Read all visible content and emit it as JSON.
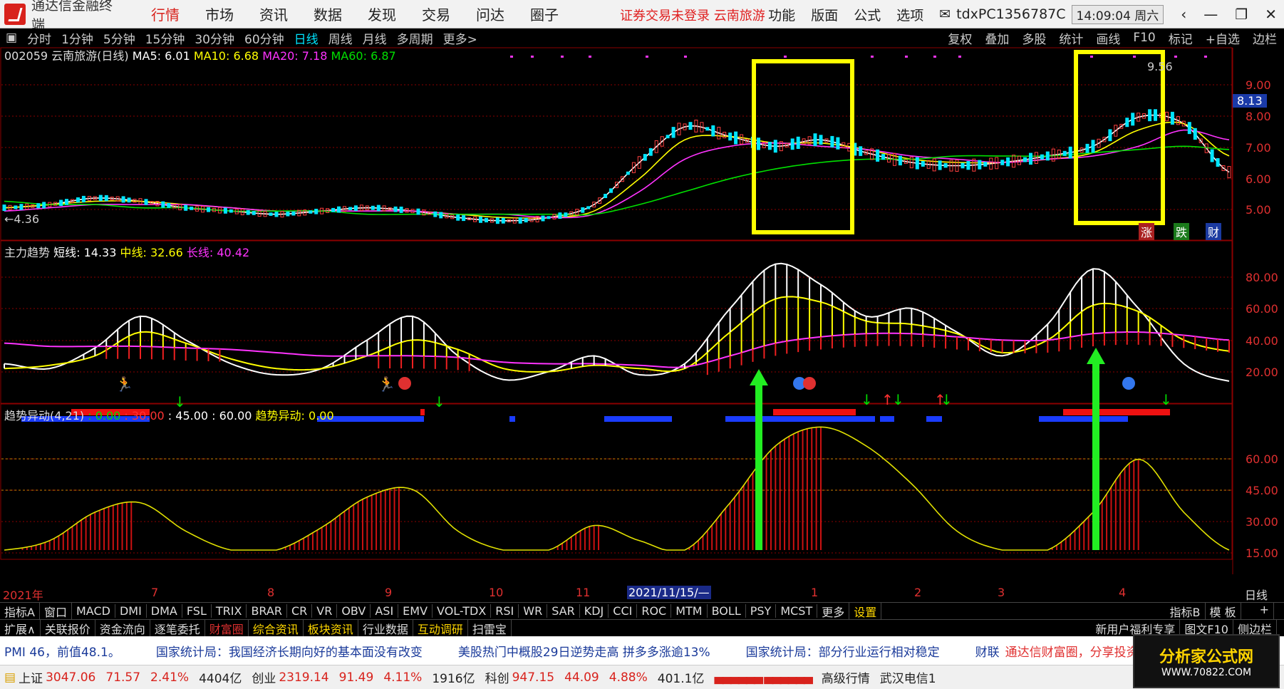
{
  "app": {
    "title": "通达信金融终端",
    "menu": [
      "行情",
      "市场",
      "资讯",
      "数据",
      "发现",
      "交易",
      "问达",
      "圈子"
    ],
    "active_menu": 0,
    "alert": "证券交易未登录  云南旅游",
    "right_menu": [
      "功能",
      "版面",
      "公式",
      "选项"
    ],
    "account": "tdxPC1356787C",
    "clock": "14:09:04 周六",
    "window_controls": [
      "‹",
      "—",
      "❐",
      "✕"
    ]
  },
  "periods": [
    "分时",
    "1分钟",
    "5分钟",
    "15分钟",
    "30分钟",
    "60分钟",
    "日线",
    "周线",
    "月线",
    "多周期",
    "更多>"
  ],
  "active_period": "日线",
  "toolbar_right": [
    "复权",
    "叠加",
    "多股",
    "统计",
    "画线",
    "F10",
    "标记",
    "+自选",
    "边栏"
  ],
  "main_panel": {
    "legend": [
      "002059 云南旅游(日线)",
      "MA5: 6.01",
      "MA10: 6.68",
      "MA20: 7.18",
      "MA60: 6.87"
    ],
    "legend_colors": [
      "#dddddd",
      "#ffffff",
      "#ffff00",
      "#ff33ff",
      "#00e000"
    ],
    "y_ticks": [
      "9.00",
      "8.00",
      "7.00",
      "6.00",
      "5.00"
    ],
    "price_tag": "8.13",
    "low_label": "←4.36",
    "high_label": "9.56",
    "badges": [
      "涨",
      "跌",
      "财"
    ]
  },
  "mid_panel": {
    "legend": [
      "主力趋势",
      "短线: 14.33",
      "中线: 32.66",
      "长线: 40.42"
    ],
    "legend_colors": [
      "#dddddd",
      "#ffffff",
      "#ffff00",
      "#ff33ff"
    ],
    "y_ticks": [
      "80.00",
      "60.00",
      "40.00",
      "20.00"
    ]
  },
  "low_panel": {
    "legend": [
      "趋势异动(4,21)",
      ": 0.00",
      ": 30.00",
      ": 45.00",
      ": 60.00",
      "趋势异动: 0.00"
    ],
    "legend_colors": [
      "#dddddd",
      "#00e000",
      "#ff3333",
      "#ffffff",
      "#ffffff",
      "#ffff00"
    ],
    "y_ticks": [
      "60.00",
      "45.00",
      "30.00",
      "15.00"
    ]
  },
  "x_axis": {
    "labels": [
      "2021年",
      "7",
      "8",
      "9",
      "10",
      "11",
      "2021/11/15/—",
      "1",
      "2",
      "3",
      "4"
    ],
    "right_label": "日线"
  },
  "indicator_tabs": [
    "指标A",
    "窗口",
    "MACD",
    "DMI",
    "DMA",
    "FSL",
    "TRIX",
    "BRAR",
    "CR",
    "VR",
    "OBV",
    "ASI",
    "EMV",
    "VOL-TDX",
    "RSI",
    "WR",
    "SAR",
    "KDJ",
    "CCI",
    "ROC",
    "MTM",
    "BOLL",
    "PSY",
    "MCST",
    "更多",
    "设置"
  ],
  "indicator_tabs_right": [
    "指标B",
    "模 板",
    "+"
  ],
  "ext_tabs": [
    "扩展∧",
    "关联报价",
    "资金流向",
    "逐笔委托",
    "财富圈",
    "综合资讯",
    "板块资讯",
    "行业数据",
    "互动调研",
    "扫雷宝"
  ],
  "ext_tabs_right": [
    "新用户福利专享",
    "图文F10",
    "侧边栏"
  ],
  "news": [
    "PMI 46，前值48.1。",
    "国家统计局：我国经济长期向好的基本面没有改变",
    "美股热门中概股29日逆势走高 拼多多涨逾13%",
    "国家统计局：部分行业运行相对稳定",
    "财联",
    "通达信财富圈，分享投资"
  ],
  "status": {
    "sh_label": "上证",
    "sh_price": "3047.06",
    "sh_chg": "71.57",
    "sh_pct": "2.41%",
    "sh_vol": "4404亿",
    "cy_label": "创业",
    "cy_price": "2319.14",
    "cy_chg": "91.49",
    "cy_pct": "4.11%",
    "cy_vol": "1916亿",
    "kc_label": "科创",
    "kc_price": "947.15",
    "kc_chg": "44.09",
    "kc_pct": "4.88%",
    "kc_vol": "401.1亿",
    "quote_level": "高级行情",
    "server": "武汉电信1"
  },
  "brand": {
    "name": "分析家公式网",
    "url": "WWW.70822.COM"
  },
  "chart_data": [
    {
      "type": "line",
      "title": "002059 云南旅游(日线)",
      "ylim": [
        4.3,
        9.8
      ],
      "series": [
        {
          "name": "MA5",
          "values": [
            5.1,
            5.2,
            5.4,
            5.3,
            5.1,
            5.0,
            4.9,
            5.0,
            5.1,
            5.0,
            4.8,
            4.7,
            4.8,
            5.2,
            6.5,
            7.6,
            7.3,
            7.0,
            7.2,
            6.8,
            6.5,
            6.4,
            6.5,
            6.7,
            7.0,
            7.9,
            7.7,
            6.2
          ]
        },
        {
          "name": "MA10",
          "values": [
            5.1,
            5.2,
            5.3,
            5.3,
            5.2,
            5.1,
            5.0,
            5.0,
            5.0,
            5.0,
            4.9,
            4.8,
            4.8,
            5.0,
            6.0,
            7.2,
            7.3,
            7.1,
            7.1,
            6.9,
            6.6,
            6.5,
            6.5,
            6.6,
            6.8,
            7.5,
            7.7,
            6.7
          ]
        },
        {
          "name": "MA20",
          "values": [
            5.0,
            5.1,
            5.2,
            5.2,
            5.2,
            5.1,
            5.0,
            5.0,
            5.0,
            5.0,
            4.9,
            4.9,
            4.8,
            4.9,
            5.6,
            6.6,
            7.0,
            7.1,
            7.0,
            6.9,
            6.7,
            6.6,
            6.5,
            6.6,
            6.7,
            7.0,
            7.5,
            7.2
          ]
        },
        {
          "name": "MA60",
          "values": [
            5.3,
            5.2,
            5.2,
            5.1,
            5.1,
            5.0,
            5.0,
            5.0,
            4.9,
            4.9,
            4.9,
            4.9,
            4.9,
            4.9,
            5.2,
            5.6,
            6.0,
            6.3,
            6.5,
            6.6,
            6.6,
            6.7,
            6.7,
            6.7,
            6.8,
            6.9,
            7.0,
            6.9
          ]
        }
      ]
    },
    {
      "type": "line",
      "title": "主力趋势",
      "ylim": [
        0,
        100
      ],
      "series": [
        {
          "name": "短线",
          "values": [
            25,
            22,
            35,
            55,
            40,
            25,
            18,
            22,
            40,
            55,
            30,
            15,
            20,
            30,
            18,
            25,
            60,
            88,
            75,
            55,
            60,
            45,
            30,
            50,
            85,
            60,
            25,
            14
          ]
        },
        {
          "name": "中线",
          "values": [
            22,
            24,
            30,
            45,
            38,
            28,
            22,
            22,
            30,
            40,
            34,
            22,
            20,
            24,
            22,
            22,
            45,
            66,
            64,
            52,
            50,
            44,
            32,
            40,
            62,
            58,
            40,
            33
          ]
        },
        {
          "name": "长线",
          "values": [
            38,
            36,
            36,
            36,
            35,
            34,
            32,
            30,
            30,
            30,
            29,
            26,
            25,
            25,
            24,
            23,
            30,
            38,
            42,
            44,
            44,
            42,
            40,
            40,
            44,
            45,
            43,
            40
          ]
        }
      ]
    },
    {
      "type": "line",
      "title": "趋势异动(4,21)",
      "ylim": [
        0,
        70
      ],
      "series": [
        {
          "name": "趋势异动",
          "values": [
            0,
            5,
            20,
            25,
            10,
            0,
            0,
            12,
            28,
            32,
            10,
            0,
            0,
            13,
            5,
            0,
            25,
            55,
            65,
            55,
            35,
            10,
            0,
            0,
            20,
            48,
            20,
            0
          ]
        }
      ]
    }
  ]
}
